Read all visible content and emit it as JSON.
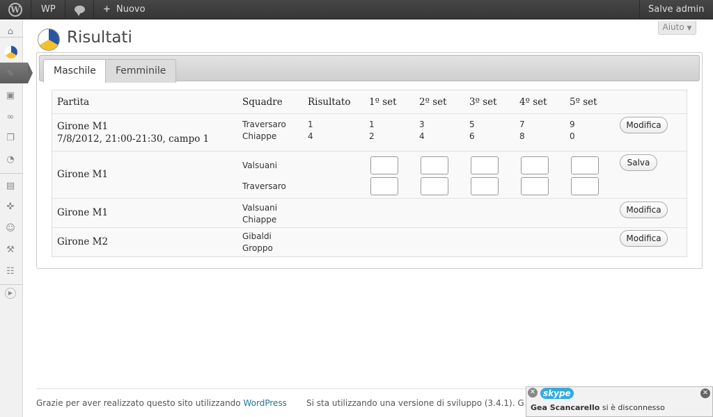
{
  "adminbar": {
    "wp_label": "WP",
    "new_label": "Nuovo",
    "user_label": "Salve admin"
  },
  "help_label": "Aiuto",
  "page_title": "Risultati",
  "tabs": [
    {
      "label": "Maschile",
      "active": true
    },
    {
      "label": "Femminile",
      "active": false
    }
  ],
  "table": {
    "headers": [
      "Partita",
      "Squadre",
      "Risultato",
      "1º set",
      "2º set",
      "3º set",
      "4º set",
      "5º set"
    ],
    "rows": [
      {
        "partita": "Girone M1",
        "partita_detail": "7/8/2012, 21:00-21:30, campo 1",
        "teams": [
          "Traversaro",
          "Chiappe"
        ],
        "risultato": [
          "1",
          "4"
        ],
        "sets": [
          [
            "1",
            "2"
          ],
          [
            "3",
            "4"
          ],
          [
            "5",
            "6"
          ],
          [
            "7",
            "8"
          ],
          [
            "9",
            "0"
          ]
        ],
        "button": "Modifica"
      },
      {
        "partita": "Girone M1",
        "teams": [
          "Valsuani",
          "Traversaro"
        ],
        "editing": true,
        "button": "Salva"
      },
      {
        "partita": "Girone M1",
        "teams": [
          "Valsuani",
          "Chiappe"
        ],
        "button": "Modifica"
      },
      {
        "partita": "Girone M2",
        "teams": [
          "Gibaldi",
          "Groppo"
        ],
        "button": "Modifica"
      }
    ]
  },
  "footer": {
    "left_text": "Grazie per aver realizzato questo sito utilizzando",
    "left_link": "WordPress",
    "right_text": "Si sta utilizzando una versione di sviluppo (3.4.1). G"
  },
  "toast": {
    "brand": "skype",
    "name": "Gea Scancarello",
    "message": "si è disconnesso"
  }
}
